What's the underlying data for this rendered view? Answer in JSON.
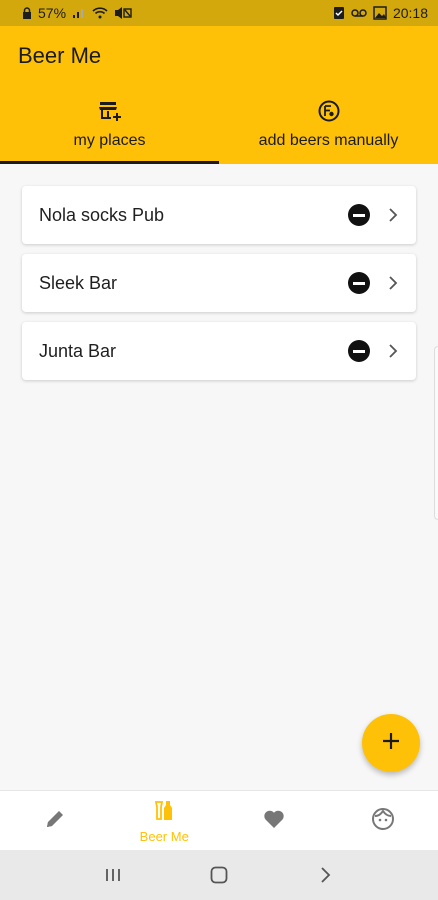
{
  "status_bar": {
    "battery_percent": "57%",
    "time": "20:18",
    "left_icons": [
      "lock-icon",
      "signal-icon",
      "wifi-icon",
      "mute-icon"
    ],
    "right_icons": [
      "checklist-icon",
      "voicemail-icon",
      "image-icon"
    ]
  },
  "app_bar": {
    "title": "Beer Me",
    "tabs": [
      {
        "label": "my places",
        "icon": "store-add-icon",
        "selected": true
      },
      {
        "label": "add beers manually",
        "icon": "beer-badge-icon",
        "selected": false
      }
    ]
  },
  "places": [
    {
      "name": "Nola socks Pub"
    },
    {
      "name": "Sleek Bar"
    },
    {
      "name": "Junta Bar"
    }
  ],
  "fab": {
    "icon": "plus-icon"
  },
  "bottom_nav": {
    "items": [
      {
        "icon": "pencil-icon",
        "label": ""
      },
      {
        "icon": "beer-bottles-icon",
        "label": "Beer Me",
        "active": true
      },
      {
        "icon": "heart-icon",
        "label": ""
      },
      {
        "icon": "face-icon",
        "label": ""
      }
    ]
  },
  "colors": {
    "primary": "#ffc107",
    "status_bar": "#d3a80c",
    "text": "#1b1b1b"
  }
}
